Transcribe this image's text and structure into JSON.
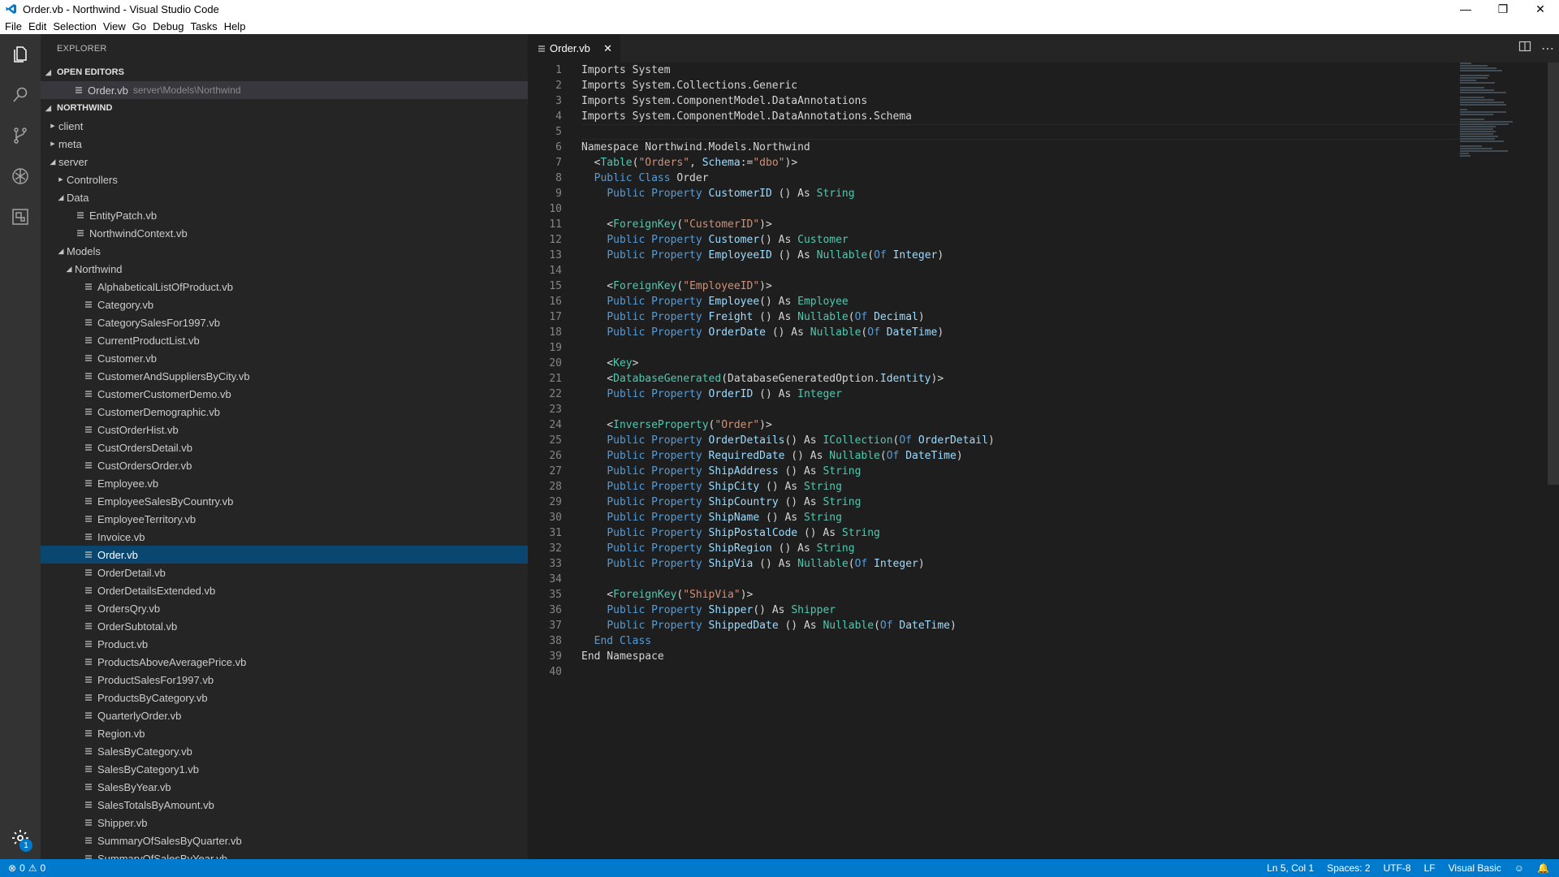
{
  "titlebar": {
    "title": "Order.vb - Northwind - Visual Studio Code"
  },
  "menu": [
    "File",
    "Edit",
    "Selection",
    "View",
    "Go",
    "Debug",
    "Tasks",
    "Help"
  ],
  "explorer": {
    "header": "EXPLORER",
    "open_editors_label": "OPEN EDITORS",
    "open_editor": {
      "name": "Order.vb",
      "path": "server\\Models\\Northwind"
    },
    "project_label": "NORTHWIND",
    "tree": [
      {
        "label": "client",
        "level": 1,
        "type": "folder",
        "open": false
      },
      {
        "label": "meta",
        "level": 1,
        "type": "folder",
        "open": false
      },
      {
        "label": "server",
        "level": 1,
        "type": "folder",
        "open": true
      },
      {
        "label": "Controllers",
        "level": 2,
        "type": "folder",
        "open": false
      },
      {
        "label": "Data",
        "level": 2,
        "type": "folder",
        "open": true
      },
      {
        "label": "EntityPatch.vb",
        "level": 3,
        "type": "file"
      },
      {
        "label": "NorthwindContext.vb",
        "level": 3,
        "type": "file"
      },
      {
        "label": "Models",
        "level": 2,
        "type": "folder",
        "open": true
      },
      {
        "label": "Northwind",
        "level": 3,
        "type": "folder",
        "open": true
      },
      {
        "label": "AlphabeticalListOfProduct.vb",
        "level": 4,
        "type": "file"
      },
      {
        "label": "Category.vb",
        "level": 4,
        "type": "file"
      },
      {
        "label": "CategorySalesFor1997.vb",
        "level": 4,
        "type": "file"
      },
      {
        "label": "CurrentProductList.vb",
        "level": 4,
        "type": "file"
      },
      {
        "label": "Customer.vb",
        "level": 4,
        "type": "file"
      },
      {
        "label": "CustomerAndSuppliersByCity.vb",
        "level": 4,
        "type": "file"
      },
      {
        "label": "CustomerCustomerDemo.vb",
        "level": 4,
        "type": "file"
      },
      {
        "label": "CustomerDemographic.vb",
        "level": 4,
        "type": "file"
      },
      {
        "label": "CustOrderHist.vb",
        "level": 4,
        "type": "file"
      },
      {
        "label": "CustOrdersDetail.vb",
        "level": 4,
        "type": "file"
      },
      {
        "label": "CustOrdersOrder.vb",
        "level": 4,
        "type": "file"
      },
      {
        "label": "Employee.vb",
        "level": 4,
        "type": "file"
      },
      {
        "label": "EmployeeSalesByCountry.vb",
        "level": 4,
        "type": "file"
      },
      {
        "label": "EmployeeTerritory.vb",
        "level": 4,
        "type": "file"
      },
      {
        "label": "Invoice.vb",
        "level": 4,
        "type": "file"
      },
      {
        "label": "Order.vb",
        "level": 4,
        "type": "file",
        "selected": true
      },
      {
        "label": "OrderDetail.vb",
        "level": 4,
        "type": "file"
      },
      {
        "label": "OrderDetailsExtended.vb",
        "level": 4,
        "type": "file"
      },
      {
        "label": "OrdersQry.vb",
        "level": 4,
        "type": "file"
      },
      {
        "label": "OrderSubtotal.vb",
        "level": 4,
        "type": "file"
      },
      {
        "label": "Product.vb",
        "level": 4,
        "type": "file"
      },
      {
        "label": "ProductsAboveAveragePrice.vb",
        "level": 4,
        "type": "file"
      },
      {
        "label": "ProductSalesFor1997.vb",
        "level": 4,
        "type": "file"
      },
      {
        "label": "ProductsByCategory.vb",
        "level": 4,
        "type": "file"
      },
      {
        "label": "QuarterlyOrder.vb",
        "level": 4,
        "type": "file"
      },
      {
        "label": "Region.vb",
        "level": 4,
        "type": "file"
      },
      {
        "label": "SalesByCategory.vb",
        "level": 4,
        "type": "file"
      },
      {
        "label": "SalesByCategory1.vb",
        "level": 4,
        "type": "file"
      },
      {
        "label": "SalesByYear.vb",
        "level": 4,
        "type": "file"
      },
      {
        "label": "SalesTotalsByAmount.vb",
        "level": 4,
        "type": "file"
      },
      {
        "label": "Shipper.vb",
        "level": 4,
        "type": "file"
      },
      {
        "label": "SummaryOfSalesByQuarter.vb",
        "level": 4,
        "type": "file"
      },
      {
        "label": "SummaryOfSalesByYear.vb",
        "level": 4,
        "type": "file"
      }
    ]
  },
  "editor": {
    "tab": "Order.vb",
    "lines": [
      [
        [
          "t",
          "Imports System"
        ]
      ],
      [
        [
          "t",
          "Imports System.Collections.Generic"
        ]
      ],
      [
        [
          "t",
          "Imports System.ComponentModel.DataAnnotations"
        ]
      ],
      [
        [
          "t",
          "Imports System.ComponentModel.DataAnnotations.Schema"
        ]
      ],
      [],
      [
        [
          "t",
          "Namespace Northwind.Models.Northwind"
        ]
      ],
      [
        [
          "t",
          "  <"
        ],
        [
          "ty",
          "Table"
        ],
        [
          "t",
          "("
        ],
        [
          "str",
          "\"Orders\""
        ],
        [
          "t",
          ", "
        ],
        [
          "id",
          "Schema"
        ],
        [
          "t",
          ":="
        ],
        [
          "str",
          "\"dbo\""
        ],
        [
          "t",
          ")>"
        ]
      ],
      [
        [
          "t",
          "  "
        ],
        [
          "kw",
          "Public Class"
        ],
        [
          "t",
          " Order"
        ]
      ],
      [
        [
          "t",
          "    "
        ],
        [
          "kw",
          "Public Property"
        ],
        [
          "t",
          " "
        ],
        [
          "id",
          "CustomerID"
        ],
        [
          "t",
          " () As "
        ],
        [
          "ty",
          "String"
        ]
      ],
      [],
      [
        [
          "t",
          "    <"
        ],
        [
          "ty",
          "ForeignKey"
        ],
        [
          "t",
          "("
        ],
        [
          "str",
          "\"CustomerID\""
        ],
        [
          "t",
          ")>"
        ]
      ],
      [
        [
          "t",
          "    "
        ],
        [
          "kw",
          "Public Property"
        ],
        [
          "t",
          " "
        ],
        [
          "id",
          "Customer"
        ],
        [
          "t",
          "() As "
        ],
        [
          "ty",
          "Customer"
        ]
      ],
      [
        [
          "t",
          "    "
        ],
        [
          "kw",
          "Public Property"
        ],
        [
          "t",
          " "
        ],
        [
          "id",
          "EmployeeID"
        ],
        [
          "t",
          " () As "
        ],
        [
          "ty",
          "Nullable"
        ],
        [
          "t",
          "("
        ],
        [
          "kw",
          "Of"
        ],
        [
          "t",
          " "
        ],
        [
          "id",
          "Integer"
        ],
        [
          "t",
          ")"
        ]
      ],
      [],
      [
        [
          "t",
          "    <"
        ],
        [
          "ty",
          "ForeignKey"
        ],
        [
          "t",
          "("
        ],
        [
          "str",
          "\"EmployeeID\""
        ],
        [
          "t",
          ")>"
        ]
      ],
      [
        [
          "t",
          "    "
        ],
        [
          "kw",
          "Public Property"
        ],
        [
          "t",
          " "
        ],
        [
          "id",
          "Employee"
        ],
        [
          "t",
          "() As "
        ],
        [
          "ty",
          "Employee"
        ]
      ],
      [
        [
          "t",
          "    "
        ],
        [
          "kw",
          "Public Property"
        ],
        [
          "t",
          " "
        ],
        [
          "id",
          "Freight"
        ],
        [
          "t",
          " () As "
        ],
        [
          "ty",
          "Nullable"
        ],
        [
          "t",
          "("
        ],
        [
          "kw",
          "Of"
        ],
        [
          "t",
          " "
        ],
        [
          "id",
          "Decimal"
        ],
        [
          "t",
          ")"
        ]
      ],
      [
        [
          "t",
          "    "
        ],
        [
          "kw",
          "Public Property"
        ],
        [
          "t",
          " "
        ],
        [
          "id",
          "OrderDate"
        ],
        [
          "t",
          " () As "
        ],
        [
          "ty",
          "Nullable"
        ],
        [
          "t",
          "("
        ],
        [
          "kw",
          "Of"
        ],
        [
          "t",
          " "
        ],
        [
          "id",
          "DateTime"
        ],
        [
          "t",
          ")"
        ]
      ],
      [],
      [
        [
          "t",
          "    <"
        ],
        [
          "ty",
          "Key"
        ],
        [
          "t",
          ">"
        ]
      ],
      [
        [
          "t",
          "    <"
        ],
        [
          "ty",
          "DatabaseGenerated"
        ],
        [
          "t",
          "(DatabaseGeneratedOption."
        ],
        [
          "id",
          "Identity"
        ],
        [
          "t",
          ")>"
        ]
      ],
      [
        [
          "t",
          "    "
        ],
        [
          "kw",
          "Public Property"
        ],
        [
          "t",
          " "
        ],
        [
          "id",
          "OrderID"
        ],
        [
          "t",
          " () As "
        ],
        [
          "ty",
          "Integer"
        ]
      ],
      [],
      [
        [
          "t",
          "    <"
        ],
        [
          "ty",
          "InverseProperty"
        ],
        [
          "t",
          "("
        ],
        [
          "str",
          "\"Order\""
        ],
        [
          "t",
          ")>"
        ]
      ],
      [
        [
          "t",
          "    "
        ],
        [
          "kw",
          "Public Property"
        ],
        [
          "t",
          " "
        ],
        [
          "id",
          "OrderDetails"
        ],
        [
          "t",
          "() As "
        ],
        [
          "ty",
          "ICollection"
        ],
        [
          "t",
          "("
        ],
        [
          "kw",
          "Of"
        ],
        [
          "t",
          " "
        ],
        [
          "id",
          "OrderDetail"
        ],
        [
          "t",
          ")"
        ]
      ],
      [
        [
          "t",
          "    "
        ],
        [
          "kw",
          "Public Property"
        ],
        [
          "t",
          " "
        ],
        [
          "id",
          "RequiredDate"
        ],
        [
          "t",
          " () As "
        ],
        [
          "ty",
          "Nullable"
        ],
        [
          "t",
          "("
        ],
        [
          "kw",
          "Of"
        ],
        [
          "t",
          " "
        ],
        [
          "id",
          "DateTime"
        ],
        [
          "t",
          ")"
        ]
      ],
      [
        [
          "t",
          "    "
        ],
        [
          "kw",
          "Public Property"
        ],
        [
          "t",
          " "
        ],
        [
          "id",
          "ShipAddress"
        ],
        [
          "t",
          " () As "
        ],
        [
          "ty",
          "String"
        ]
      ],
      [
        [
          "t",
          "    "
        ],
        [
          "kw",
          "Public Property"
        ],
        [
          "t",
          " "
        ],
        [
          "id",
          "ShipCity"
        ],
        [
          "t",
          " () As "
        ],
        [
          "ty",
          "String"
        ]
      ],
      [
        [
          "t",
          "    "
        ],
        [
          "kw",
          "Public Property"
        ],
        [
          "t",
          " "
        ],
        [
          "id",
          "ShipCountry"
        ],
        [
          "t",
          " () As "
        ],
        [
          "ty",
          "String"
        ]
      ],
      [
        [
          "t",
          "    "
        ],
        [
          "kw",
          "Public Property"
        ],
        [
          "t",
          " "
        ],
        [
          "id",
          "ShipName"
        ],
        [
          "t",
          " () As "
        ],
        [
          "ty",
          "String"
        ]
      ],
      [
        [
          "t",
          "    "
        ],
        [
          "kw",
          "Public Property"
        ],
        [
          "t",
          " "
        ],
        [
          "id",
          "ShipPostalCode"
        ],
        [
          "t",
          " () As "
        ],
        [
          "ty",
          "String"
        ]
      ],
      [
        [
          "t",
          "    "
        ],
        [
          "kw",
          "Public Property"
        ],
        [
          "t",
          " "
        ],
        [
          "id",
          "ShipRegion"
        ],
        [
          "t",
          " () As "
        ],
        [
          "ty",
          "String"
        ]
      ],
      [
        [
          "t",
          "    "
        ],
        [
          "kw",
          "Public Property"
        ],
        [
          "t",
          " "
        ],
        [
          "id",
          "ShipVia"
        ],
        [
          "t",
          " () As "
        ],
        [
          "ty",
          "Nullable"
        ],
        [
          "t",
          "("
        ],
        [
          "kw",
          "Of"
        ],
        [
          "t",
          " "
        ],
        [
          "id",
          "Integer"
        ],
        [
          "t",
          ")"
        ]
      ],
      [],
      [
        [
          "t",
          "    <"
        ],
        [
          "ty",
          "ForeignKey"
        ],
        [
          "t",
          "("
        ],
        [
          "str",
          "\"ShipVia\""
        ],
        [
          "t",
          ")>"
        ]
      ],
      [
        [
          "t",
          "    "
        ],
        [
          "kw",
          "Public Property"
        ],
        [
          "t",
          " "
        ],
        [
          "id",
          "Shipper"
        ],
        [
          "t",
          "() As "
        ],
        [
          "ty",
          "Shipper"
        ]
      ],
      [
        [
          "t",
          "    "
        ],
        [
          "kw",
          "Public Property"
        ],
        [
          "t",
          " "
        ],
        [
          "id",
          "ShippedDate"
        ],
        [
          "t",
          " () As "
        ],
        [
          "ty",
          "Nullable"
        ],
        [
          "t",
          "("
        ],
        [
          "kw",
          "Of"
        ],
        [
          "t",
          " "
        ],
        [
          "id",
          "DateTime"
        ],
        [
          "t",
          ")"
        ]
      ],
      [
        [
          "t",
          "  "
        ],
        [
          "kw",
          "End Class"
        ]
      ],
      [
        [
          "t",
          "End Namespace"
        ]
      ],
      []
    ]
  },
  "status": {
    "errors": "0",
    "warnings": "0",
    "position": "Ln 5, Col 1",
    "spaces": "Spaces: 2",
    "encoding": "UTF-8",
    "eol": "LF",
    "language": "Visual Basic"
  },
  "settings_badge": "1"
}
